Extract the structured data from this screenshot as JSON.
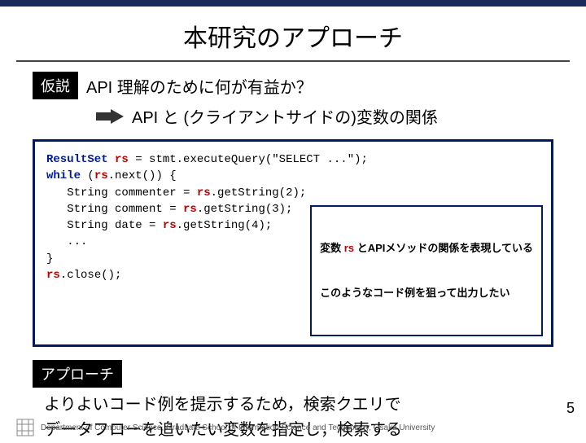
{
  "title": "本研究のアプローチ",
  "hypothesis": {
    "tag": "仮説",
    "question": "API 理解のために何が有益か？",
    "relation": "API と (クライアントサイドの)変数の関係"
  },
  "code": {
    "kw_resultset": "ResultSet",
    "rs_decl": "rs",
    "assign1": " = stmt.executeQuery(\"SELECT ...\");",
    "kw_while": "while",
    "l2_open": " (",
    "rs_use1": "rs",
    "l2_rest": ".next()) {",
    "l3_indent": "   String commenter = ",
    "rs_use2": "rs",
    "l3_rest": ".getString(2);",
    "l4_indent": "   String comment = ",
    "rs_use3": "rs",
    "l4_rest": ".getString(3);",
    "l5_indent": "   String date = ",
    "rs_use4": "rs",
    "l5_rest": ".getString(4);",
    "l6": "   ...",
    "l7": "}",
    "rs_use5": "rs",
    "l8_rest": ".close();"
  },
  "callout": {
    "line1_pre": "変数 ",
    "line1_var": "rs",
    "line1_post": " とAPIメソッドの関係を表現している",
    "line2": "このようなコード例を狙って出力したい"
  },
  "approach": {
    "tag": "アプローチ",
    "summary_l1": "よりよいコード例を提示するため，検索クエリで",
    "summary_l2": "データフローを追いたい変数を指定し，検索する"
  },
  "pagenum": "5",
  "footer": "Department of Computer Science, Graduate School of Information Science and Technology, Osaka University"
}
